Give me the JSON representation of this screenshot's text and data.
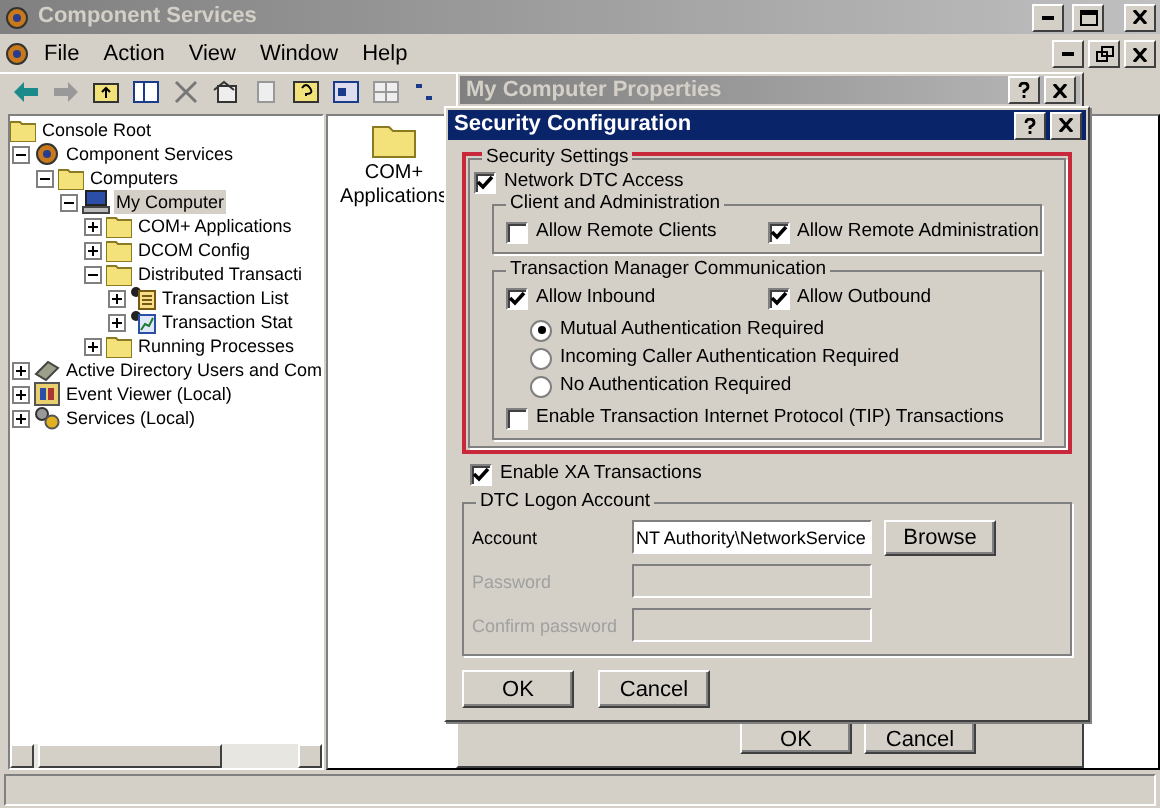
{
  "window": {
    "title": "Component Services"
  },
  "menu": [
    "File",
    "Action",
    "View",
    "Window",
    "Help"
  ],
  "tree": [
    {
      "label": "Console Root",
      "kind": "folder",
      "selected": false,
      "children": [
        {
          "label": "Component Services",
          "kind": "gear",
          "selected": false,
          "expanded": true,
          "children": [
            {
              "label": "Computers",
              "kind": "folder",
              "selected": false,
              "expanded": true,
              "children": [
                {
                  "label": "My Computer",
                  "kind": "computer",
                  "selected": true,
                  "expanded": true,
                  "children": [
                    {
                      "label": "COM+ Applications",
                      "kind": "folder",
                      "selected": false,
                      "expanded": false
                    },
                    {
                      "label": "DCOM Config",
                      "kind": "folder",
                      "selected": false,
                      "expanded": false
                    },
                    {
                      "label": "Distributed Transacti",
                      "kind": "folder",
                      "selected": false,
                      "expanded": true,
                      "children": [
                        {
                          "label": "Transaction List",
                          "kind": "list",
                          "selected": false,
                          "expanded": false
                        },
                        {
                          "label": "Transaction Stat",
                          "kind": "chart",
                          "selected": false,
                          "expanded": false
                        }
                      ]
                    },
                    {
                      "label": "Running Processes",
                      "kind": "folder",
                      "selected": false,
                      "expanded": false
                    }
                  ]
                }
              ]
            }
          ]
        },
        {
          "label": "Active Directory Users and Com",
          "kind": "directory",
          "selected": false,
          "expanded": false
        },
        {
          "label": "Event Viewer (Local)",
          "kind": "event",
          "selected": false,
          "expanded": false
        },
        {
          "label": "Services (Local)",
          "kind": "services",
          "selected": false,
          "expanded": false
        }
      ]
    }
  ],
  "details": [
    {
      "label": "COM+ Applications"
    }
  ],
  "properties_dialog": {
    "title": "My Computer Properties",
    "buttons": [
      "OK",
      "Cancel"
    ]
  },
  "security_dialog": {
    "title": "Security Configuration",
    "security_settings": {
      "title": "Security Settings",
      "network_dtc_access": {
        "label": "Network DTC Access",
        "checked": true
      },
      "client_and_administration": {
        "title": "Client and Administration",
        "options": [
          {
            "label": "Allow Remote Clients",
            "checked": false
          },
          {
            "label": "Allow Remote Administration",
            "checked": true
          }
        ]
      },
      "transaction_manager_communication": {
        "title": "Transaction Manager Communication",
        "options": [
          {
            "label": "Allow Inbound",
            "checked": true
          },
          {
            "label": "Allow Outbound",
            "checked": true
          }
        ],
        "authentication": [
          {
            "label": "Mutual Authentication Required",
            "selected": true
          },
          {
            "label": "Incoming Caller Authentication Required",
            "selected": false
          },
          {
            "label": "No Authentication Required",
            "selected": false
          }
        ]
      },
      "tip_transactions": {
        "label": "Enable Transaction Internet Protocol (TIP) Transactions",
        "checked": false
      }
    },
    "xa_transactions": {
      "label": "Enable XA Transactions",
      "checked": true
    },
    "logon": {
      "title": "DTC Logon Account",
      "fields": [
        {
          "label": "Account",
          "value": "NT Authority\\NetworkService",
          "disabled": false
        },
        {
          "label": "Password",
          "disabled": true
        },
        {
          "label": "Confirm password",
          "disabled": true
        }
      ],
      "browse": "Browse"
    },
    "buttons": [
      "OK",
      "Cancel"
    ]
  }
}
